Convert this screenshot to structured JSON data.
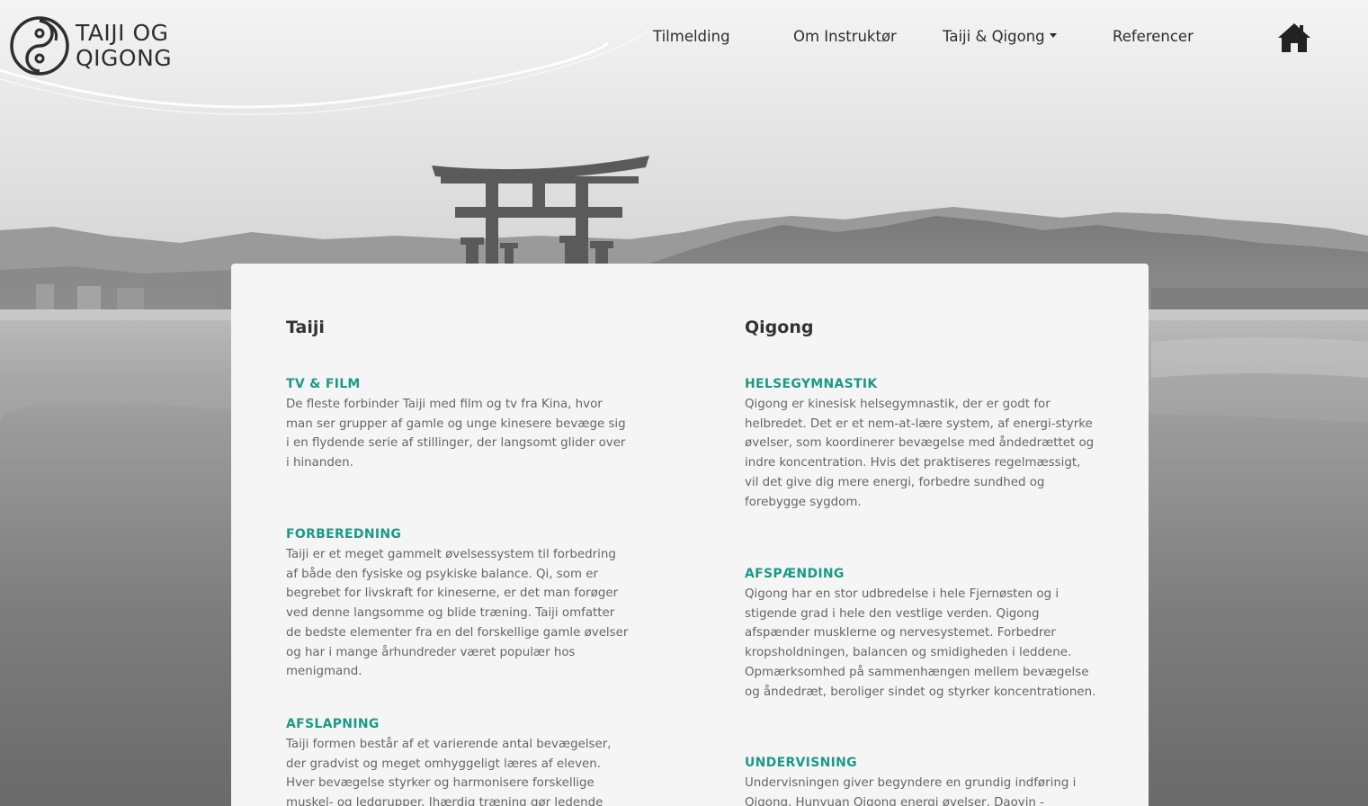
{
  "header": {
    "logo": {
      "line1": "TAIJI OG",
      "line2": "QIGONG"
    },
    "nav": [
      {
        "label": "Tilmelding"
      },
      {
        "label": "Om Instruktør"
      },
      {
        "label": "Taiji & Qigong",
        "has_dropdown": true
      },
      {
        "label": "Referencer"
      }
    ],
    "home_icon": "home-icon"
  },
  "colors": {
    "accent": "#1b9a86",
    "heading": "#333333",
    "body_text": "#666666",
    "card_bg": "#f5f5f5"
  },
  "taiji": {
    "title": "Taiji",
    "sections": [
      {
        "heading": "TV & FILM",
        "text": "De fleste forbinder Taiji med film og tv fra Kina, hvor man ser grupper af gamle og unge kinesere bevæge sig i en flydende serie af stillinger, der langsomt glider over i hinanden."
      },
      {
        "heading": "FORBEREDNING",
        "text": "Taiji er et meget gammelt øvelsessystem til forbedring af både den fysiske og psykiske balance. Qi, som er begrebet for livskraft for kineserne, er det man forøger ved denne langsomme og blide træning. Taiji omfatter de bedste elementer fra en del forskellige gamle øvelser og har i mange århundreder været populær hos menigmand."
      },
      {
        "heading": "AFSLAPNING",
        "text": "Taiji formen består af et varierende antal bevægelser, der gradvist og meget omhyggeligt læres af eleven. Hver bevægelse styrker og harmonisere forskellige muskel- og ledgrupper. Ihærdig træning gør ledende mere smidige og"
      }
    ]
  },
  "qigong": {
    "title": "Qigong",
    "sections": [
      {
        "heading": "HELSEGYMNASTIK",
        "text": "Qigong er kinesisk helsegymnastik, der er godt for helbredet. Det er et nem-at-lære system, af energi-styrke øvelser, som koordinerer bevægelse med åndedrættet og indre koncentration. Hvis det praktiseres regelmæssigt, vil det give dig mere energi, forbedre sundhed og forebygge sygdom."
      },
      {
        "heading": "AFSPÆNDING",
        "text": "Qigong har en stor udbredelse i hele Fjernøsten og i stigende grad i hele den vestlige verden. Qigong afspænder musklerne og nervesystemet. Forbedrer kropsholdningen, balancen og smidigheden i leddene. Opmærksomhed på sammenhængen mellem bevægelse og åndedræt, beroliger sindet og styrker koncentrationen."
      },
      {
        "heading": "UNDERVISNING",
        "text": "Undervisningen giver begyndere en grundig indføring i Qigong, Hunyuan Qigong energi øvelser, Daoyin -"
      }
    ]
  }
}
